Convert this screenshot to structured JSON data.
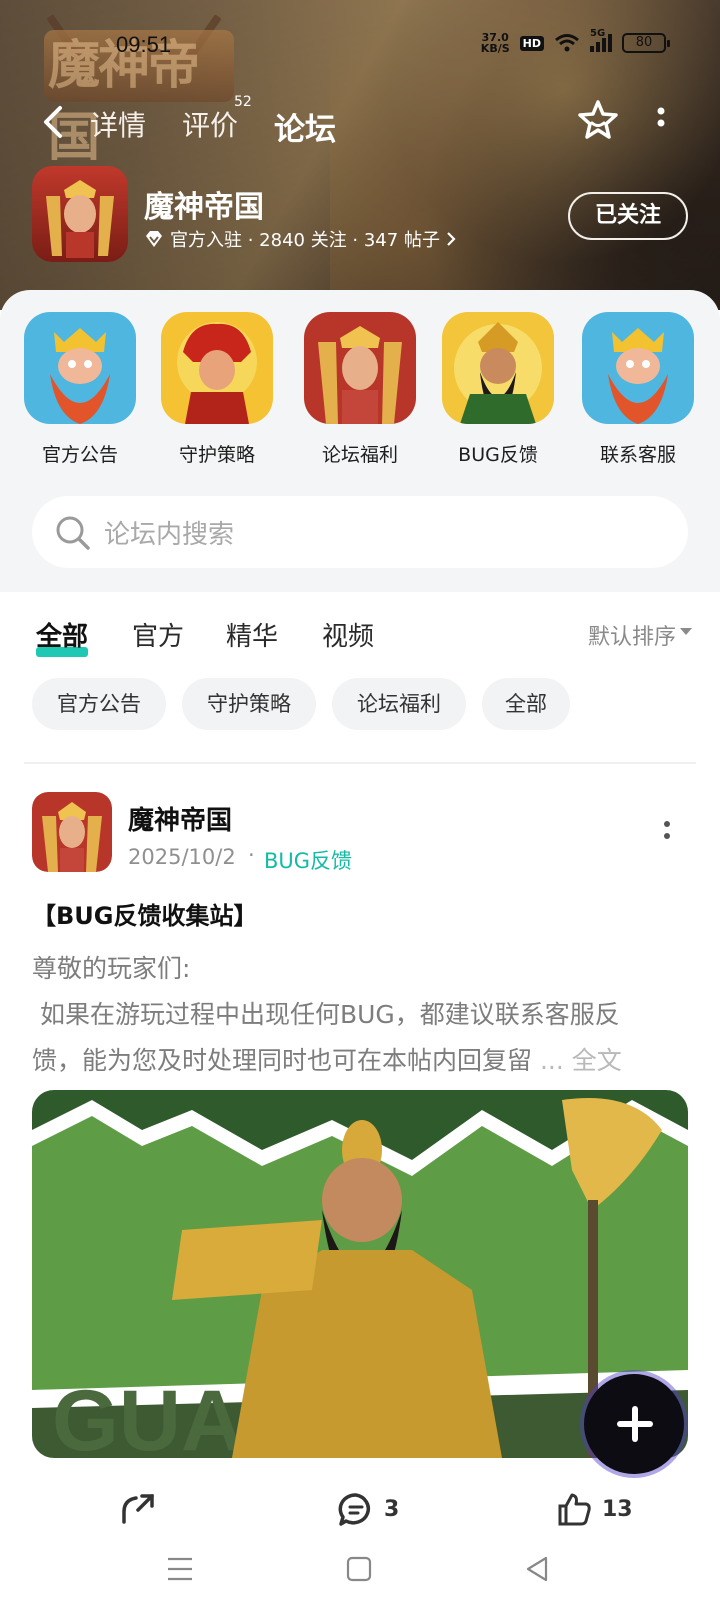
{
  "status_bar": {
    "time": "09:51",
    "net_speed_value": "37.0",
    "net_speed_unit": "KB/S",
    "hd": "HD",
    "network": "5G",
    "battery": "80"
  },
  "nav": {
    "tabs": [
      {
        "label": "详情"
      },
      {
        "label": "评价",
        "badge": "52"
      },
      {
        "label": "论坛"
      }
    ],
    "active_tab": "论坛"
  },
  "header": {
    "logo_text": "魔神帝国",
    "game_name": "魔神帝国",
    "meta": "官方入驻 · 2840 关注 · 347 帖子",
    "follow_label": "已关注"
  },
  "quick_entries": [
    {
      "label": "官方公告",
      "icon": "dwarf-king-icon"
    },
    {
      "label": "守护策略",
      "icon": "fire-warrior-icon"
    },
    {
      "label": "论坛福利",
      "icon": "golden-king-icon"
    },
    {
      "label": "BUG反馈",
      "icon": "bearded-general-icon"
    },
    {
      "label": "联系客服",
      "icon": "dwarf-king-icon"
    }
  ],
  "search": {
    "placeholder": "论坛内搜索"
  },
  "feed_tabs": [
    {
      "label": "全部"
    },
    {
      "label": "官方"
    },
    {
      "label": "精华"
    },
    {
      "label": "视频"
    }
  ],
  "sort_label": "默认排序",
  "chips": [
    {
      "label": "官方公告"
    },
    {
      "label": "守护策略"
    },
    {
      "label": "论坛福利"
    },
    {
      "label": "全部"
    }
  ],
  "post": {
    "author": "魔神帝国",
    "date": "2025/10/2",
    "category": "BUG反馈",
    "title": "【BUG反馈收集站】",
    "body_line1": "尊敬的玩家们:",
    "body_line2": " 如果在游玩过程中出现任何BUG，都建议联系客服反",
    "body_line3": "馈，能为您及时处理同时也可在本帖内回复留",
    "ellipsis": " ... ",
    "full_text": "全文",
    "image_watermark": "GUANYU",
    "comments": "3",
    "likes": "13"
  },
  "colors": {
    "accent": "#1fc8b2",
    "category_text": "#13bba6",
    "page_bg": "#ffffff",
    "panel_bg": "#f4f5f7"
  }
}
